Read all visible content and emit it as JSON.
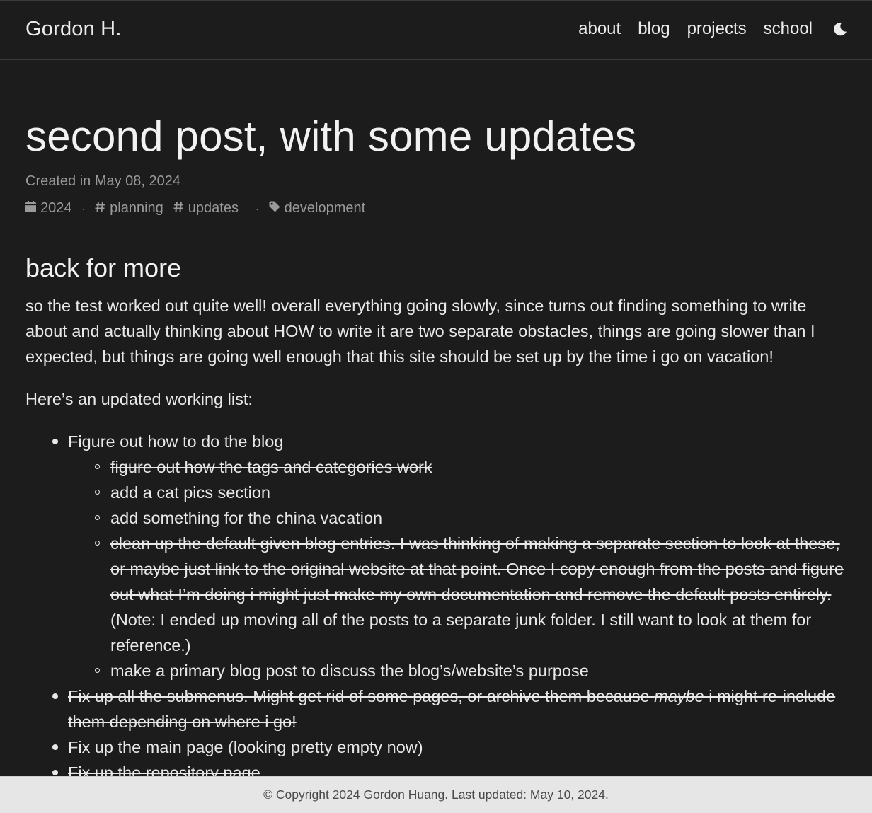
{
  "nav": {
    "brand": "Gordon H.",
    "links": [
      "about",
      "blog",
      "projects",
      "school"
    ],
    "theme_toggle_icon": "moon-icon"
  },
  "post": {
    "title": "second post, with some updates",
    "date": "Created in May 08, 2024",
    "year": "2024",
    "tags": [
      "planning",
      "updates"
    ],
    "category": "development",
    "heading": "back for more",
    "paragraph1": "so the test worked out quite well! overall everything going slowly, since turns out finding something to write about and actually thinking about HOW to write it are two separate obstacles, things are going slower than I expected, but things are going well enough that this site should be set up by the time i go on vacation!",
    "paragraph2": "Here’s an updated working list:",
    "list": {
      "item1": "Figure out how to do the blog",
      "sub1": "figure out how the tags and categories work",
      "sub2": "add a cat pics section",
      "sub3": "add something for the china vacation",
      "sub4_struck": "clean up the default given blog entries. I was thinking of making a separate section to look at these, or maybe just link to the original website at that point. Once I copy enough from the posts and figure out what I’m doing i might just make my own documentation and remove the default posts entirely.",
      "sub4_note": " (Note: I ended up moving all of the posts to a separate junk folder. I still want to look at them for reference.)",
      "sub5": "make a primary blog post to discuss the blog’s/website’s purpose",
      "item2_a": "Fix up all the submenus. Might get rid of some pages, or archive them because ",
      "item2_em": "maybe",
      "item2_b": " i might re-include them depending on where i go!",
      "item3": "Fix up the main page (looking pretty empty now)",
      "item4": "Fix up the repository page"
    }
  },
  "footer": {
    "text": "© Copyright 2024 Gordon Huang. Last updated: May 10, 2024."
  },
  "colors": {
    "background": "#1c1c1d",
    "text": "#ececec",
    "muted": "#9a9a9a",
    "footer_bg": "#e6e6e6"
  }
}
